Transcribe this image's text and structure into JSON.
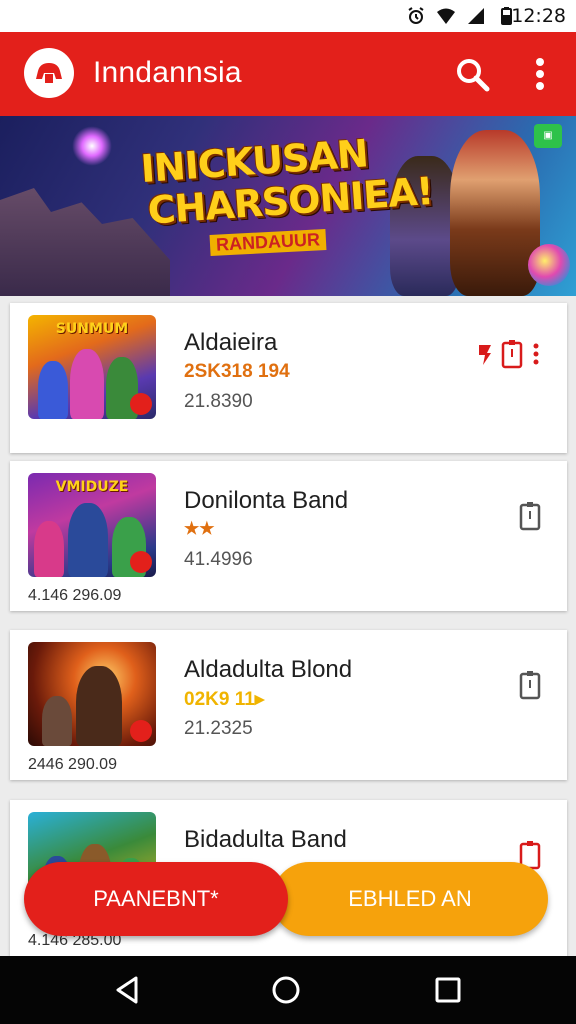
{
  "status_bar": {
    "time": "12:28",
    "icons": [
      "alarm-icon",
      "wifi-icon",
      "signal-icon",
      "battery-icon"
    ]
  },
  "app_bar": {
    "title": "Inndannsia",
    "background": "#e3201b",
    "actions": [
      "search-icon",
      "more-vert-icon"
    ]
  },
  "banner": {
    "title_line1": "INICKUSAN",
    "title_line2": "CHARSONIEA!",
    "tag": "RANDAUUR"
  },
  "items": [
    {
      "thumb_label": "SUNMUM",
      "name": "Aldaieira",
      "code": "2SK318 194",
      "code_color": "#e07010",
      "value": "21.8390",
      "extra": "",
      "action_icons": [
        "red-flag-icon",
        "bookmark-icon",
        "more-dots-icon"
      ]
    },
    {
      "thumb_label": "VMIDUZE",
      "name": "Donilonta Band",
      "code": "★★",
      "code_color": "#e07010",
      "value": "41.4996",
      "extra": "4.146 296.09",
      "action_icons": [
        "bookmark-icon"
      ]
    },
    {
      "thumb_label": "",
      "name": "Aldadulta Blond",
      "code": "02K9 11▸",
      "code_color": "#f0b400",
      "value": "21.2325",
      "extra": "2446 290.09",
      "action_icons": [
        "bookmark-icon"
      ]
    },
    {
      "thumb_label": "",
      "name": "Bidadulta Band",
      "code": "",
      "code_color": "#e07010",
      "value": "",
      "extra": "4.146 285.00",
      "action_icons": [
        "bookmark-icon"
      ]
    }
  ],
  "buttons": {
    "payment": "PAANEBNT*",
    "enabled": "EBHLED AN"
  },
  "nav": [
    "back-icon",
    "home-icon",
    "recents-icon"
  ]
}
